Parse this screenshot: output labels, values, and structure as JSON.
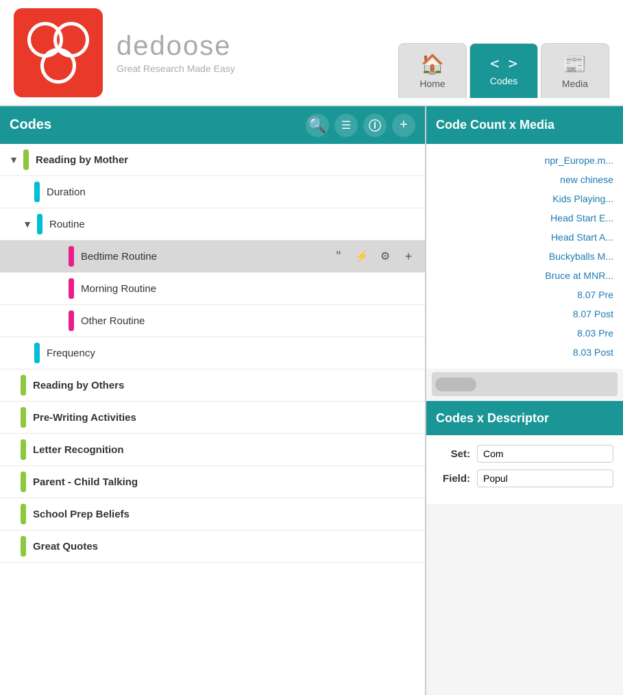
{
  "app": {
    "name": "dedoose",
    "tagline": "Great Research Made Easy"
  },
  "nav": {
    "tabs": [
      {
        "id": "home",
        "label": "Home",
        "icon": "🏠",
        "active": false
      },
      {
        "id": "codes",
        "label": "Codes",
        "icon": "◁▷",
        "active": true
      },
      {
        "id": "media",
        "label": "Media",
        "icon": "📰",
        "active": false
      }
    ]
  },
  "codes_panel": {
    "title": "Codes",
    "actions": [
      "search",
      "filter",
      "info",
      "add"
    ]
  },
  "code_tree": [
    {
      "id": "reading-by-mother",
      "name": "Reading by Mother",
      "color": "green",
      "indent": 0,
      "expandable": true,
      "expanded": true,
      "bold": true
    },
    {
      "id": "duration",
      "name": "Duration",
      "color": "cyan",
      "indent": 1,
      "expandable": false
    },
    {
      "id": "routine",
      "name": "Routine",
      "color": "cyan",
      "indent": 1,
      "expandable": true,
      "expanded": true,
      "bold": false
    },
    {
      "id": "bedtime-routine",
      "name": "Bedtime Routine",
      "color": "magenta",
      "indent": 2,
      "expandable": false,
      "selected": true
    },
    {
      "id": "morning-routine",
      "name": "Morning Routine",
      "color": "magenta",
      "indent": 2,
      "expandable": false
    },
    {
      "id": "other-routine",
      "name": "Other Routine",
      "color": "magenta",
      "indent": 2,
      "expandable": false
    },
    {
      "id": "frequency",
      "name": "Frequency",
      "color": "cyan",
      "indent": 1,
      "expandable": false
    },
    {
      "id": "reading-by-others",
      "name": "Reading by Others",
      "color": "green",
      "indent": 0,
      "expandable": false,
      "bold": true
    },
    {
      "id": "pre-writing",
      "name": "Pre-Writing Activities",
      "color": "green",
      "indent": 0,
      "expandable": false,
      "bold": true
    },
    {
      "id": "letter-recognition",
      "name": "Letter Recognition",
      "color": "green",
      "indent": 0,
      "expandable": false,
      "bold": true
    },
    {
      "id": "parent-child-talking",
      "name": "Parent - Child Talking",
      "color": "green",
      "indent": 0,
      "expandable": false,
      "bold": true
    },
    {
      "id": "school-prep-beliefs",
      "name": "School Prep Beliefs",
      "color": "green",
      "indent": 0,
      "expandable": false,
      "bold": true
    },
    {
      "id": "great-quotes",
      "name": "Great Quotes",
      "color": "green",
      "indent": 0,
      "expandable": false,
      "bold": true
    }
  ],
  "right_panel": {
    "code_count_title": "Code Count x Media",
    "media_items": [
      "npr_Europe.m...",
      "new chinese",
      "Kids Playing...",
      "Head Start E...",
      "Head Start A...",
      "Buckyballs M...",
      "Bruce at MNR...",
      "8.07 Pre",
      "8.07 Post",
      "8.03 Pre",
      "8.03 Post"
    ],
    "descriptor_title": "Codes x Descriptor",
    "set_label": "Set:",
    "set_value": "Com",
    "field_label": "Field:",
    "field_value": "Popul"
  },
  "colors": {
    "teal": "#1a9696",
    "red": "#e8392a",
    "green_bar": "#8dc63f",
    "cyan_bar": "#00bcd4",
    "magenta_bar": "#e91e8c",
    "link_blue": "#1a7ab5"
  }
}
